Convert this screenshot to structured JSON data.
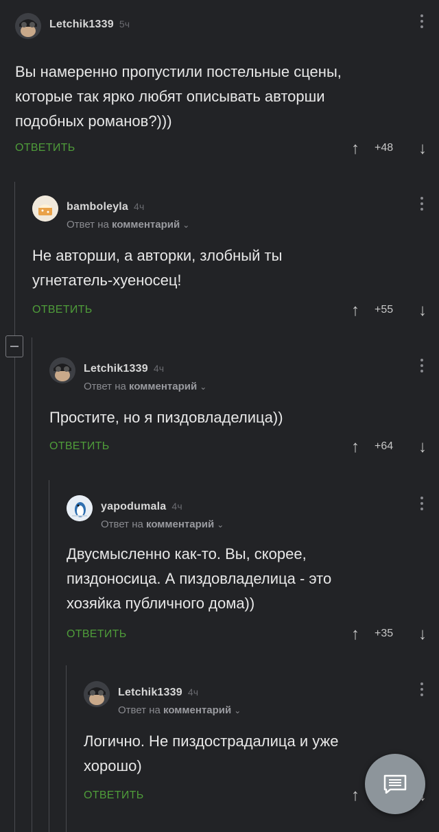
{
  "comments": [
    {
      "author": "Letchik1339",
      "time": "5ч",
      "text_lines": [
        "Вы намеренно пропустили постельные сцены,",
        "которые так ярко любят описывать авторши",
        "подобных романов?)))"
      ],
      "reply_label": "ОТВЕТИТЬ",
      "score": "+48"
    },
    {
      "author": "bamboleyla",
      "time": "4ч",
      "reply_prefix": "Ответ на",
      "reply_target": "комментарий",
      "text_lines": [
        "Не авторши, а авторки, злобный ты",
        "угнетатель-хуеносец!"
      ],
      "reply_label": "ОТВЕТИТЬ",
      "score": "+55"
    },
    {
      "author": "Letchik1339",
      "time": "4ч",
      "reply_prefix": "Ответ на",
      "reply_target": "комментарий",
      "text_lines": [
        "Простите, но я пиздовладелица))"
      ],
      "reply_label": "ОТВЕТИТЬ",
      "score": "+64"
    },
    {
      "author": "yapodumala",
      "time": "4ч",
      "reply_prefix": "Ответ на",
      "reply_target": "комментарий",
      "text_lines": [
        "Двусмысленно как-то. Вы, скорее,",
        "пиздоносица. А пиздовладелица - это",
        "хозяйка публичного дома))"
      ],
      "reply_label": "ОТВЕТИТЬ",
      "score": "+35"
    },
    {
      "author": "Letchik1339",
      "time": "4ч",
      "reply_prefix": "Ответ на",
      "reply_target": "комментарий",
      "text_lines": [
        "Логично. Не пиздострадалица и уже",
        "хорошо)"
      ],
      "reply_label": "ОТВЕТИТЬ"
    }
  ],
  "colors": {
    "background": "#222326",
    "reply_link": "#4f9d3a",
    "fab": "#8d959b"
  },
  "icons": {
    "fab": "comment-list-icon",
    "upvote": "arrow-up-icon",
    "downvote": "arrow-down-icon",
    "collapse": "minus-icon"
  }
}
